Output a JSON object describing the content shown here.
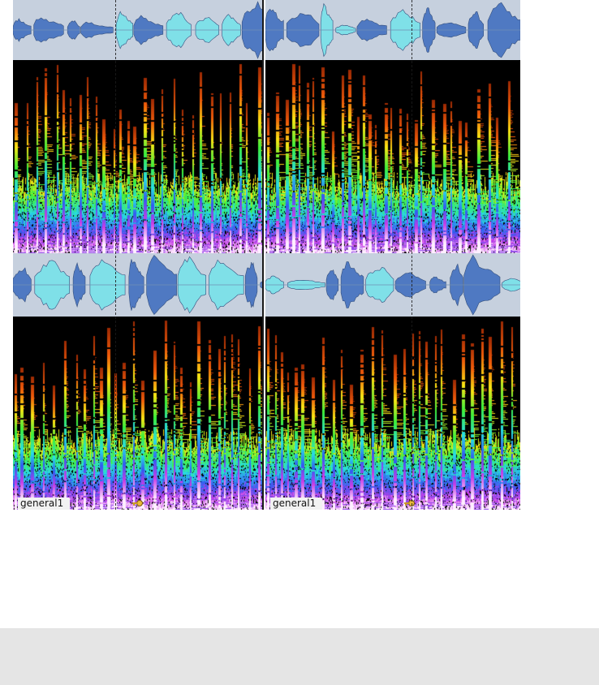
{
  "tracks": [
    {
      "clips": [
        {
          "label": ""
        },
        {
          "label": ""
        }
      ]
    },
    {
      "clips": [
        {
          "label": "general1"
        },
        {
          "label": "general1"
        }
      ]
    }
  ],
  "colors": {
    "waveform_bg": "#c6d0de",
    "waveform_fill_cyan": "#7fe0e8",
    "waveform_fill_blue": "#4f79c2",
    "spectrogram_bg": "#000000",
    "playhead": "#1a1a1a",
    "bottom_bar": "#e5e5e5"
  },
  "icons": {
    "fade_handle": "key-icon"
  }
}
